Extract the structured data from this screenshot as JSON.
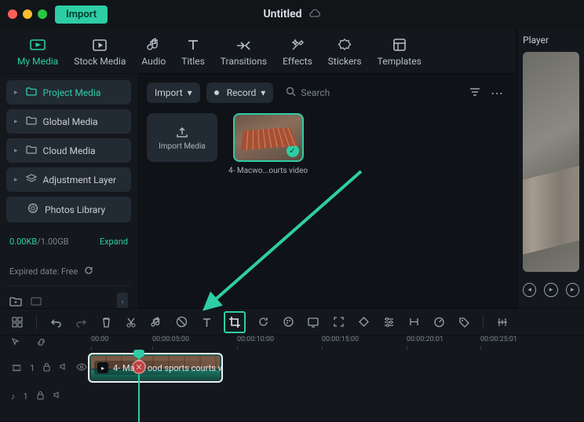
{
  "titlebar": {
    "import_btn": "Import",
    "doc_title": "Untitled"
  },
  "media_tabs": [
    {
      "id": "my-media",
      "label": "My Media",
      "active": true
    },
    {
      "id": "stock-media",
      "label": "Stock Media"
    },
    {
      "id": "audio",
      "label": "Audio"
    },
    {
      "id": "titles",
      "label": "Titles"
    },
    {
      "id": "transitions",
      "label": "Transitions"
    },
    {
      "id": "effects",
      "label": "Effects"
    },
    {
      "id": "stickers",
      "label": "Stickers"
    },
    {
      "id": "templates",
      "label": "Templates"
    }
  ],
  "sidebar": {
    "items": [
      {
        "id": "project",
        "label": "Project Media",
        "selected": true,
        "expandable": true
      },
      {
        "id": "global",
        "label": "Global Media",
        "expandable": true
      },
      {
        "id": "cloud",
        "label": "Cloud Media",
        "expandable": true
      },
      {
        "id": "adjustment",
        "label": "Adjustment Layer",
        "expandable": true
      },
      {
        "id": "photos",
        "label": "Photos Library",
        "expandable": false
      }
    ],
    "storage_used": "0.00KB",
    "storage_cap": "/1.00GB",
    "expand": "Expand",
    "expiry": "Expired date: Free"
  },
  "media_pane": {
    "import_dd": "Import",
    "record_dd": "Record",
    "search_ph": "Search",
    "import_tile": "Import Media",
    "clip_name": "4- Macwo...ourts video"
  },
  "player": {
    "label": "Player"
  },
  "timeline": {
    "ticks": [
      "00:00",
      "00:00:05:00",
      "00:00:10:00",
      "00:00:15:00",
      "00:00:20:01",
      "00:00:25:01"
    ],
    "video_track": "1",
    "audio_track": "1",
    "clip_label": "4- Ma      ood sports courts vi"
  },
  "toolbar": {
    "tools": [
      {
        "id": "match",
        "name": "match-cut-icon"
      },
      {
        "id": "undo",
        "name": "undo-icon"
      },
      {
        "id": "redo",
        "name": "redo-icon"
      },
      {
        "id": "delete",
        "name": "delete-icon"
      },
      {
        "id": "split",
        "name": "split-icon"
      },
      {
        "id": "music",
        "name": "music-icon"
      },
      {
        "id": "nolink",
        "name": "unlink-icon"
      },
      {
        "id": "text",
        "name": "text-icon"
      },
      {
        "id": "crop",
        "name": "crop-icon",
        "highlight": true
      },
      {
        "id": "rotate",
        "name": "rotate-icon"
      },
      {
        "id": "color",
        "name": "color-icon"
      },
      {
        "id": "screen",
        "name": "screen-icon"
      },
      {
        "id": "focus",
        "name": "focus-icon"
      },
      {
        "id": "keyframe",
        "name": "keyframe-icon"
      },
      {
        "id": "adjust",
        "name": "adjust-icon"
      },
      {
        "id": "bracket",
        "name": "bracket-icon"
      },
      {
        "id": "speed",
        "name": "speed-icon"
      },
      {
        "id": "tag",
        "name": "tag-icon"
      },
      {
        "id": "render",
        "name": "render-icon"
      }
    ]
  },
  "colors": {
    "accent": "#2ecda6"
  }
}
